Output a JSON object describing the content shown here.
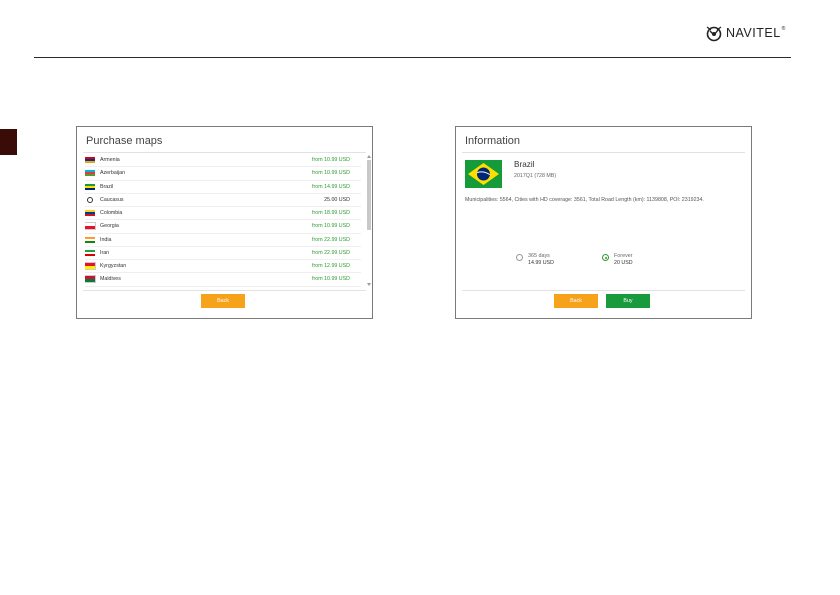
{
  "brand": {
    "name": "NAVITEL",
    "mark": "®"
  },
  "purchase": {
    "title": "Purchase maps",
    "items": [
      {
        "name": "Armenia",
        "price": "from 10.99 USD",
        "flag_colors": [
          "#d90012",
          "#0033a0",
          "#f2a800"
        ]
      },
      {
        "name": "Azerbaijan",
        "price": "from 10.99 USD",
        "flag_colors": [
          "#00b5e2",
          "#ef3340",
          "#509e2f"
        ]
      },
      {
        "name": "Brazil",
        "price": "from 14.99 USD",
        "flag_colors": [
          "#169b3a",
          "#fedf00",
          "#002776"
        ]
      },
      {
        "name": "Caucasus",
        "price": "25.00 USD",
        "flag_colors": []
      },
      {
        "name": "Colombia",
        "price": "from 18.99 USD",
        "flag_colors": [
          "#fcd116",
          "#003893",
          "#ce1126"
        ]
      },
      {
        "name": "Georgia",
        "price": "from 10.99 USD",
        "flag_colors": [
          "#ffffff",
          "#e8112d"
        ]
      },
      {
        "name": "India",
        "price": "from 22.99 USD",
        "flag_colors": [
          "#ff9933",
          "#ffffff",
          "#138808"
        ]
      },
      {
        "name": "Iran",
        "price": "from 22.99 USD",
        "flag_colors": [
          "#239f40",
          "#ffffff",
          "#da0000"
        ]
      },
      {
        "name": "Kyrgyzstan",
        "price": "from 12.99 USD",
        "flag_colors": [
          "#e8112d",
          "#ffef00"
        ]
      },
      {
        "name": "Maldives",
        "price": "from 10.99 USD",
        "flag_colors": [
          "#d21034",
          "#007e3a"
        ]
      }
    ],
    "back_label": "Back"
  },
  "info": {
    "title": "Information",
    "country": "Brazil",
    "version": "2017Q1 (728 MB)",
    "description": "Municipalities: 5564, Cities with HD coverage: 3561, Total Road Length (km): 1139808, POI: 2319234.",
    "options": [
      {
        "label": "365 days",
        "price": "14.99 USD",
        "selected": false
      },
      {
        "label": "Forever",
        "price": "20 USD",
        "selected": true
      }
    ],
    "back_label": "Back",
    "buy_label": "Buy"
  },
  "colors": {
    "accent_orange": "#f7a21b",
    "accent_green": "#199b3d",
    "price_green": "#2f9b2f"
  }
}
